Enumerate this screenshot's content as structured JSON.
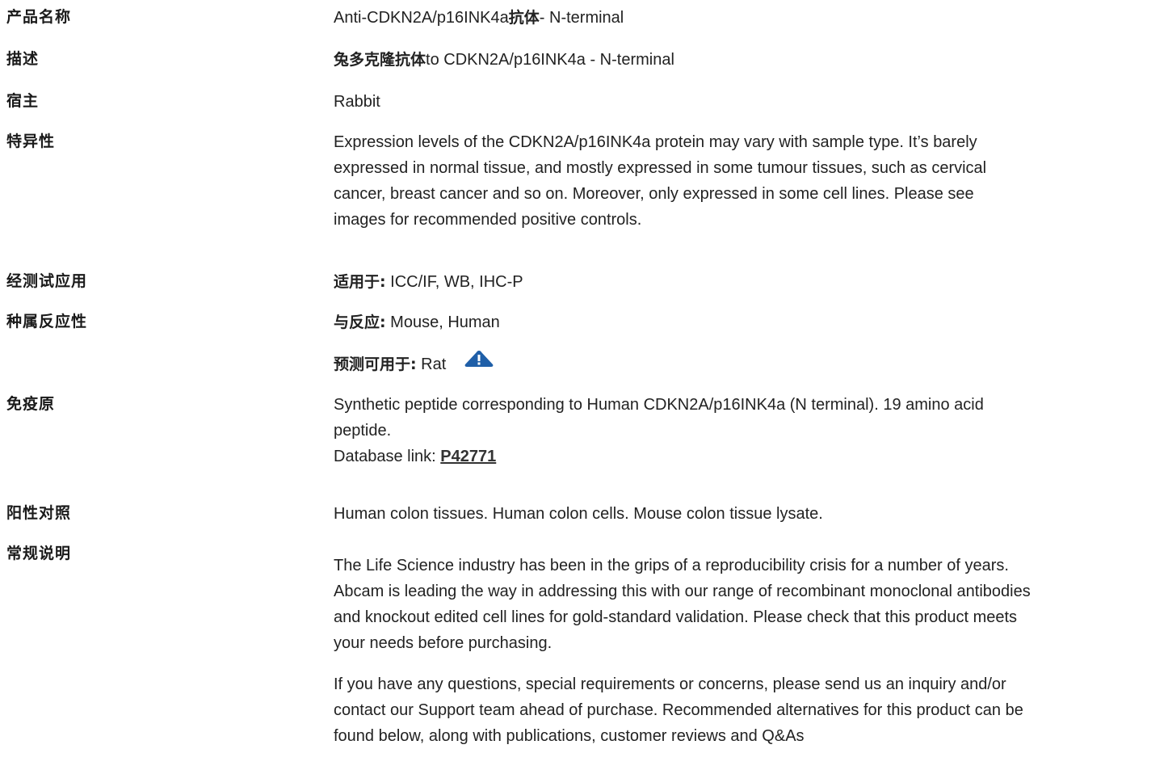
{
  "rows": {
    "product_name": {
      "label": "产品名称",
      "value_prefix": "Anti-CDKN2A/p16INK4a",
      "value_cn": "抗体",
      "value_suffix": "- N-terminal"
    },
    "description": {
      "label": "描述",
      "value_cn": "兔多克隆抗体",
      "value_suffix": "to CDKN2A/p16INK4a - N-terminal"
    },
    "host": {
      "label": "宿主",
      "value": "Rabbit"
    },
    "specificity": {
      "label": "特异性",
      "lines": [
        "Expression levels of the CDKN2A/p16INK4a protein may vary with sample type. It’s barely",
        "expressed in normal tissue, and mostly expressed in some tumour tissues, such as cervical",
        "cancer, breast cancer and so on. Moreover, only expressed in some cell lines. Please see",
        "images for recommended positive controls."
      ]
    },
    "tested_applications": {
      "label": "经测试应用",
      "prefix": "适用于:",
      "value": "ICC/IF, WB, IHC-P"
    },
    "species_reactivity": {
      "label": "种属反应性",
      "reacts_prefix": "与反应:",
      "reacts_value": "Mouse, Human",
      "predicted_prefix": "预测可用于:",
      "predicted_value": "Rat",
      "predicted_icon": "warning-triangle-icon"
    },
    "immunogen": {
      "label": "免疫原",
      "lines": [
        "Synthetic peptide corresponding to Human CDKN2A/p16INK4a (N terminal). 19 amino acid",
        "peptide."
      ],
      "db_prefix": "Database link: ",
      "db_link": "P42771"
    },
    "positive_control": {
      "label": "阳性对照",
      "value": "Human colon tissues. Human colon cells. Mouse colon tissue lysate."
    },
    "general_notes": {
      "label": "常规说明",
      "para1_lines": [
        "The Life Science industry has been in the grips of a reproducibility crisis for a number of years.",
        "Abcam is leading the way in addressing this with our range of recombinant monoclonal antibodies",
        "and knockout edited cell lines for gold-standard validation. Please check that this product meets",
        "your needs before purchasing."
      ],
      "para2_lines": [
        "If you have any questions, special requirements or concerns, please send us an inquiry and/or",
        "contact our Support team ahead of purchase. Recommended alternatives for this product can be",
        "found below, along with publications, customer reviews and Q&As"
      ]
    }
  },
  "colors": {
    "text": "#222222",
    "icon": "#1f5fa8"
  }
}
